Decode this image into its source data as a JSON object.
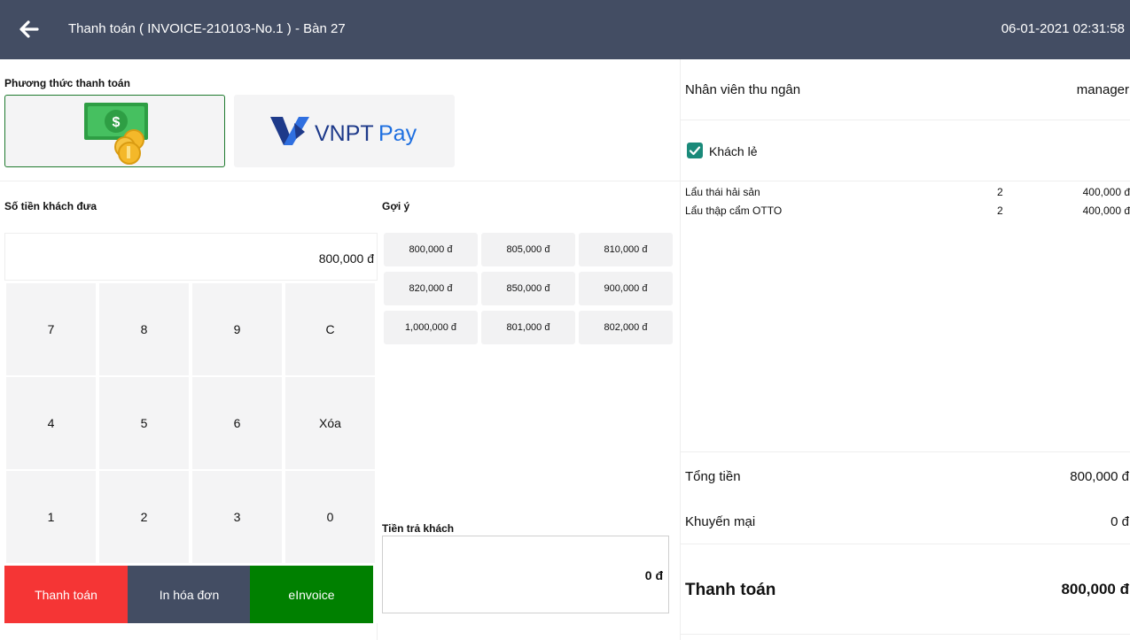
{
  "header": {
    "title": "Thanh toán ( INVOICE-210103-No.1 ) - Bàn 27",
    "datetime": "06-01-2021 02:31:58"
  },
  "payment_method": {
    "label": "Phương thức thanh toán",
    "methods": [
      {
        "name": "cash",
        "selected": true
      },
      {
        "name": "VNPTPay",
        "logo_text_dark": "VNPT",
        "logo_text_blue": "Pay",
        "selected": false
      }
    ]
  },
  "amount": {
    "label": "Số tiền khách đưa",
    "value": "800,000 đ"
  },
  "keypad": {
    "keys": [
      "7",
      "8",
      "9",
      "C",
      "4",
      "5",
      "6",
      "Xóa",
      "1",
      "2",
      "3",
      "0"
    ]
  },
  "suggestions": {
    "label": "Gợi ý",
    "items": [
      "800,000 đ",
      "805,000 đ",
      "810,000 đ",
      "820,000 đ",
      "850,000 đ",
      "900,000 đ",
      "1,000,000 đ",
      "801,000 đ",
      "802,000 đ"
    ]
  },
  "change": {
    "label": "Tiền trả khách",
    "value": "0 đ"
  },
  "actions": {
    "pay_label": "Thanh toán",
    "print_label": "In hóa đơn",
    "einvoice_label": "eInvoice"
  },
  "summary": {
    "cashier_label": "Nhân viên thu ngân",
    "cashier_value": "manager",
    "walkin_label": "Khách lẻ",
    "walkin_checked": true,
    "items": [
      {
        "name": "Lẩu thái hải sản",
        "qty": "2",
        "price": "400,000 đ"
      },
      {
        "name": "Lẩu thập cẩm OTTO",
        "qty": "2",
        "price": "400,000 đ"
      }
    ],
    "total_label": "Tổng tiền",
    "total_value": "800,000 đ",
    "discount_label": "Khuyến mại",
    "discount_value": "0 đ",
    "grand_label": "Thanh toán",
    "grand_value": "800,000 đ"
  },
  "colors": {
    "header_bg": "#434d63",
    "pay_button": "#f53535",
    "print_button": "#434d63",
    "einvoice_button": "#008000",
    "checkbox": "#1a8a7a",
    "vnpt_blue": "#1e6fe0"
  }
}
